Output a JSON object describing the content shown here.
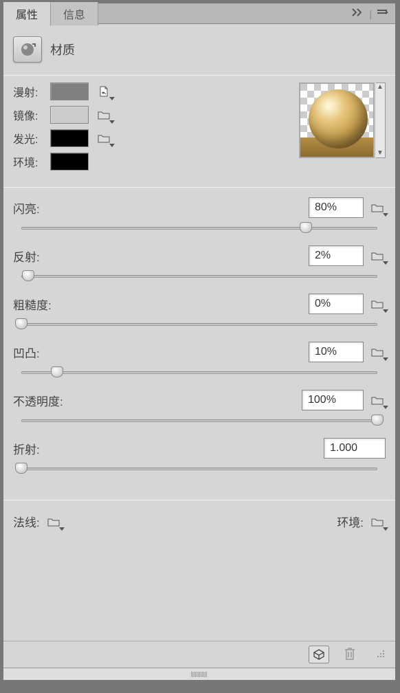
{
  "tabs": {
    "properties": "属性",
    "info": "信息"
  },
  "panel_title": "材质",
  "colors": {
    "diffuse_label": "漫射:",
    "diffuse_color": "#808080",
    "mirror_label": "镜像:",
    "mirror_color": "#cccccc",
    "emission_label": "发光:",
    "emission_color": "#000000",
    "environment_label": "环境:",
    "environment_color": "#000000"
  },
  "sliders": {
    "shine_label": "闪亮:",
    "shine_value": "80%",
    "shine_pct": 80,
    "reflection_label": "反射:",
    "reflection_value": "2%",
    "reflection_pct": 2,
    "roughness_label": "粗糙度:",
    "roughness_value": "0%",
    "roughness_pct": 0,
    "bump_label": "凹凸:",
    "bump_value": "10%",
    "bump_pct": 10,
    "opacity_label": "不透明度:",
    "opacity_value": "100%",
    "opacity_pct": 100,
    "refraction_label": "折射:",
    "refraction_value": "1.000",
    "refraction_pct": 0
  },
  "bottom": {
    "normals_label": "法线:",
    "environment_label": "环境:"
  }
}
